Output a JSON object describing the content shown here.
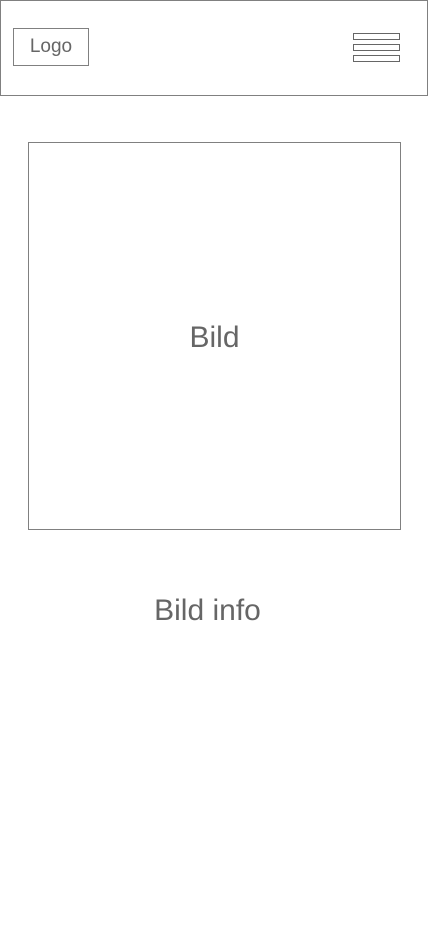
{
  "header": {
    "logo_label": "Logo",
    "menu_icon": "hamburger-menu-icon"
  },
  "main": {
    "image_label": "Bild",
    "image_info": "Bild info"
  },
  "colors": {
    "border": "#808080",
    "text": "#666666",
    "background": "#ffffff"
  }
}
